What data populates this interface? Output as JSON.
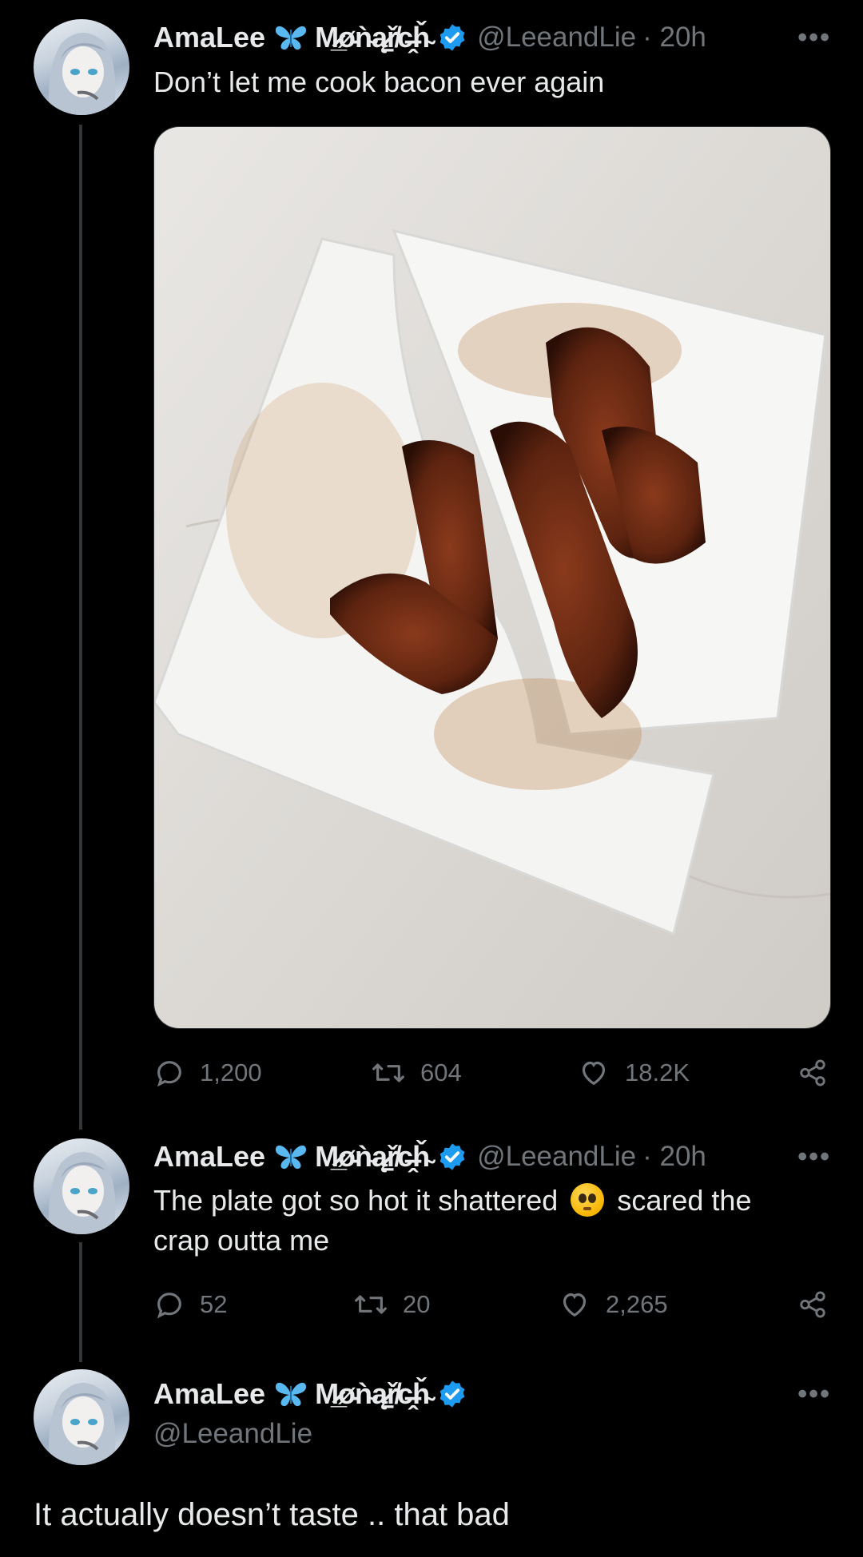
{
  "tweets": [
    {
      "display_name": "AmaLee",
      "name_suffix": "M̷̲ø̵ǹ̴ą̷̠ř̸c̶̭ȟ̴",
      "handle": "@LeeandLie",
      "time": "· 20h",
      "text": "Don’t let me cook bacon ever again",
      "replies": "1,200",
      "reposts": "604",
      "likes": "18.2K",
      "media": "photo of burnt bacon strips on a shattered white square plate"
    },
    {
      "display_name": "AmaLee",
      "name_suffix": "M̷̲ø̵ǹ̴ą̷̠ř̸c̶̭ȟ̴",
      "handle": "@LeeandLie",
      "time": "· 20h",
      "text_before_emoji": "The plate got so hot it shattered",
      "emoji": "flushed-face",
      "text_after_emoji": "scared the",
      "text_line2": "crap outta me",
      "replies": "52",
      "reposts": "20",
      "likes": "2,265"
    },
    {
      "display_name": "AmaLee",
      "name_suffix": "M̷̲ø̵ǹ̴ą̷̠ř̸c̶̭ȟ̴",
      "handle": "@LeeandLie",
      "text": "It actually doesn’t taste .. that bad"
    }
  ],
  "more_label": "•••",
  "icons": {
    "butterfly": "butterfly-icon",
    "verified": "verified-badge-icon",
    "reply": "reply-icon",
    "repost": "repost-icon",
    "like": "heart-icon",
    "share": "share-icon",
    "more": "more-icon"
  },
  "colors": {
    "background": "#000000",
    "text": "#e7e9ea",
    "muted": "#71767b",
    "verified": "#1d9bf0",
    "butterfly": "#5ab8f0"
  }
}
